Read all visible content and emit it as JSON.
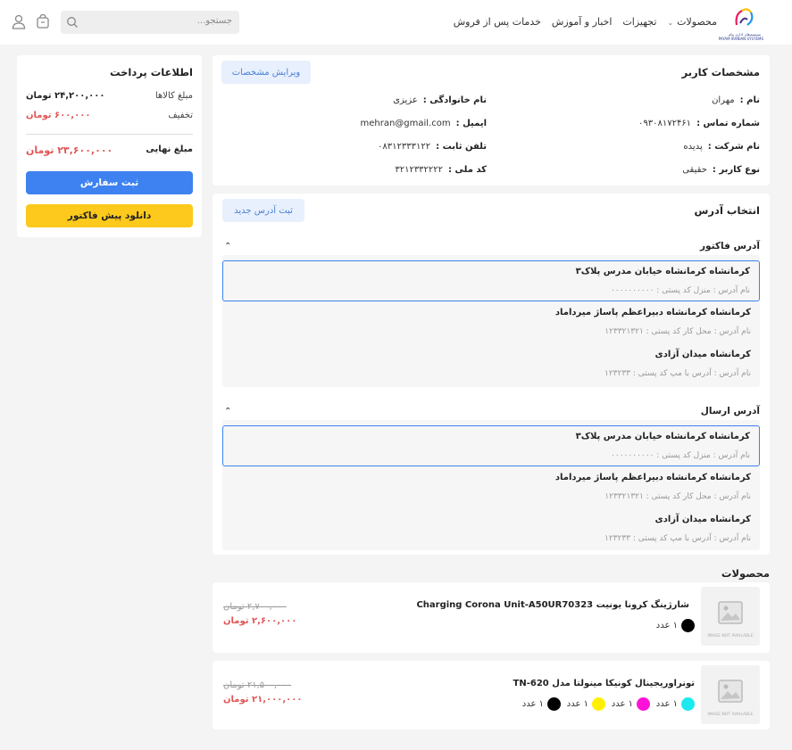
{
  "header": {
    "logo_caption": "سیستم‌های اداری پیام\nPAYAM IRANIAN SYSTEMS",
    "nav": [
      {
        "label": "محصولات",
        "has_dropdown": true
      },
      {
        "label": "تجهیزات"
      },
      {
        "label": "اخبار و آموزش"
      },
      {
        "label": "خدمات پس از فروش"
      }
    ],
    "search_placeholder": "جستجو..."
  },
  "user_info": {
    "title": "مشخصات کاربر",
    "edit_button": "ویرایش مشخصات",
    "fields": {
      "first_name": {
        "label": "نام :",
        "value": "مهران"
      },
      "last_name": {
        "label": "نام خانوادگی :",
        "value": "عزیزی"
      },
      "phone": {
        "label": "شماره تماس :",
        "value": "۰۹۳۰۸۱۷۲۴۶۱"
      },
      "email": {
        "label": "ایمیل :",
        "value": "mehran@gmail.com"
      },
      "company": {
        "label": "نام شرکت :",
        "value": "پدیده"
      },
      "landline": {
        "label": "تلفن ثابت :",
        "value": "۰۸۳۱۲۳۳۳۱۲۲"
      },
      "user_type": {
        "label": "نوع کاربر :",
        "value": "حقیقی"
      },
      "national_code": {
        "label": "کد ملی :",
        "value": "۳۲۱۲۳۳۲۲۲۲"
      }
    }
  },
  "address": {
    "title": "انتخاب آدرس",
    "new_button": "ثبت آدرس جدید",
    "invoice": {
      "title": "آدرس فاکتور",
      "items": [
        {
          "line1": "کرمانشاه کرمانشاه خیابان مدرس پلاک۳",
          "line2": "نام آدرس : منزل  کد پستی : ۰۰۰۰۰۰۰۰۰۰",
          "selected": true
        },
        {
          "line1": "کرمانشاه کرمانشاه دبیراعظم پاساژ میرداماد",
          "line2": "نام آدرس : محل کار  کد پستی : ۱۲۳۳۲۱۳۲۱",
          "selected": false
        },
        {
          "line1": "کرمانشاه میدان آزادی",
          "line2": "نام آدرس : آدرس با مپ  کد پستی : ۱۲۳۲۳۳",
          "selected": false
        }
      ]
    },
    "shipping": {
      "title": "آدرس ارسال",
      "items": [
        {
          "line1": "کرمانشاه کرمانشاه خیابان مدرس پلاک۳",
          "line2": "نام آدرس : منزل  کد پستی : ۰۰۰۰۰۰۰۰۰۰",
          "selected": true
        },
        {
          "line1": "کرمانشاه کرمانشاه دبیراعظم پاساژ میرداماد",
          "line2": "نام آدرس : محل کار  کد پستی : ۱۲۳۳۲۱۳۲۱",
          "selected": false
        },
        {
          "line1": "کرمانشاه میدان آزادی",
          "line2": "نام آدرس : آدرس با مپ  کد پستی : ۱۲۳۲۳۳",
          "selected": false
        }
      ]
    }
  },
  "products": {
    "title": "محصولات",
    "no_image_text": "IMAGE NOT AVAILABLE",
    "items": [
      {
        "name": "شارژینگ کرونا یونیت Charging Corona Unit-A50UR70323",
        "old_price": "۲,۷۰۰,۰۰۰ تومان",
        "new_price": "۲,۶۰۰,۰۰۰ تومان",
        "colors": [
          {
            "color": "#000000",
            "qty": "۱ عدد"
          }
        ]
      },
      {
        "name": "تونراوریجینال کونیکا مینولتا مدل TN-620",
        "old_price": "۲۱,۵۰۰,۰۰۰ تومان",
        "new_price": "۲۱,۰۰۰,۰۰۰ تومان",
        "colors": [
          {
            "color": "#1ce8ef",
            "qty": "۱ عدد"
          },
          {
            "color": "#ff12d8",
            "qty": "۱ عدد"
          },
          {
            "color": "#fff000",
            "qty": "۱ عدد"
          },
          {
            "color": "#000000",
            "qty": "۱ عدد"
          }
        ]
      }
    ]
  },
  "payment": {
    "title": "اطلاعات پرداخت",
    "items_label": "مبلغ کالاها",
    "items_value": "۲۴,۲۰۰,۰۰۰ تومان",
    "discount_label": "تخفیف",
    "discount_value": "۶۰۰,۰۰۰ تومان",
    "final_label": "مبلغ نهایی",
    "final_value": "۲۳,۶۰۰,۰۰۰ تومان",
    "submit_button": "ثبت سفارش",
    "download_button": "دانلود پیش فاکتور"
  }
}
